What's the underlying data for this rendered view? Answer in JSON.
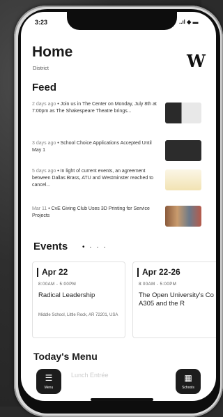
{
  "status": {
    "time": "3:23",
    "icons": "..ıl ◆ ▬"
  },
  "header": {
    "title": "Home",
    "subtitle": "District",
    "logo_letter": "W"
  },
  "feed": {
    "title": "Feed",
    "items": [
      {
        "meta": "2 days ago",
        "text": "Join us in The Center on Monday, July 8th at 7:00pm as The Shakespeare Theatre brings..."
      },
      {
        "meta": "3 days ago",
        "text": "School Choice Applications Accepted Until May 1"
      },
      {
        "meta": "5 days ago",
        "text": "In light of current events, an agreement between Dallas Brass, ATU and Westminster reached to cancel..."
      },
      {
        "meta": "Mar 11",
        "text": "CvE Giving Club Uses 3D Printing for Service Projects"
      }
    ]
  },
  "events": {
    "title": "Events",
    "dots": "• · · ·",
    "cards": [
      {
        "date": "Apr 22",
        "time": "8:00AM - 5:00PM",
        "name": "Radical Leadership",
        "location": "Middle School, Little Rock, AR 72201, USA"
      },
      {
        "date": "Apr 22-26",
        "time": "8:00AM - 5:00PM",
        "name": "The Open University's Co A305 and the R",
        "location": ""
      }
    ]
  },
  "menu": {
    "title": "Today's Menu",
    "faint": "Lunch Entrée"
  },
  "fab_left": {
    "label": "Menu",
    "glyph": "☰"
  },
  "fab_right": {
    "label": "Schools",
    "glyph": "▦"
  }
}
